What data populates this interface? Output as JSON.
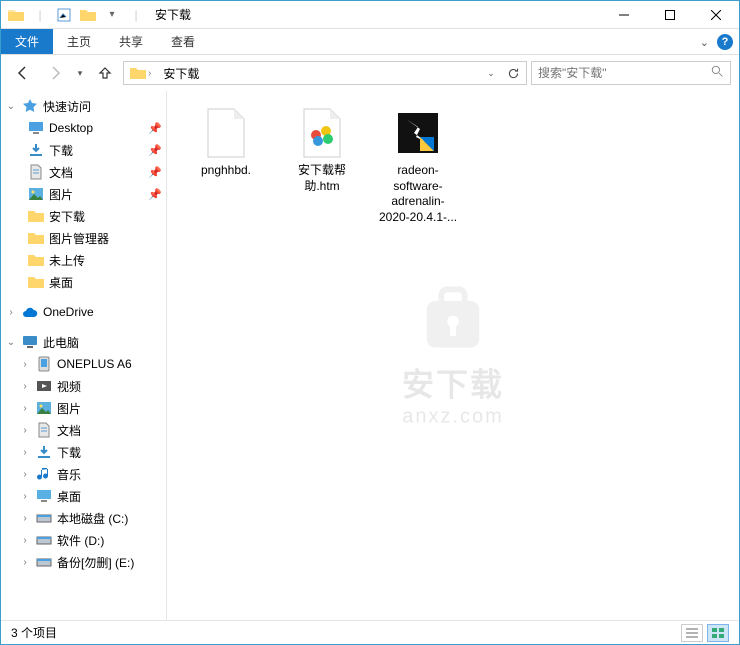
{
  "window": {
    "title": "安下载"
  },
  "ribbon": {
    "file": "文件",
    "home": "主页",
    "share": "共享",
    "view": "查看"
  },
  "nav": {
    "address_root_icon": "folder",
    "crumbs": [
      "安下载"
    ],
    "search_placeholder": "搜索\"安下载\""
  },
  "sidebar": {
    "quick_access": {
      "label": "快速访问",
      "expanded": true
    },
    "quick_items": [
      {
        "label": "Desktop",
        "icon": "desktop",
        "pinned": true
      },
      {
        "label": "下载",
        "icon": "downloads",
        "pinned": true
      },
      {
        "label": "文档",
        "icon": "documents",
        "pinned": true
      },
      {
        "label": "图片",
        "icon": "pictures",
        "pinned": true
      },
      {
        "label": "安下载",
        "icon": "folder",
        "pinned": false
      },
      {
        "label": "图片管理器",
        "icon": "folder",
        "pinned": false
      },
      {
        "label": "未上传",
        "icon": "folder",
        "pinned": false
      },
      {
        "label": "桌面",
        "icon": "folder",
        "pinned": false
      }
    ],
    "onedrive": {
      "label": "OneDrive"
    },
    "this_pc": {
      "label": "此电脑",
      "expanded": true
    },
    "pc_items": [
      {
        "label": "ONEPLUS A6",
        "icon": "phone"
      },
      {
        "label": "视频",
        "icon": "videos"
      },
      {
        "label": "图片",
        "icon": "pictures"
      },
      {
        "label": "文档",
        "icon": "documents"
      },
      {
        "label": "下载",
        "icon": "downloads"
      },
      {
        "label": "音乐",
        "icon": "music"
      },
      {
        "label": "桌面",
        "icon": "desktop-lib"
      },
      {
        "label": "本地磁盘 (C:)",
        "icon": "drive"
      },
      {
        "label": "软件 (D:)",
        "icon": "drive"
      },
      {
        "label": "备份[勿删] (E:)",
        "icon": "drive"
      }
    ]
  },
  "files": [
    {
      "name": "pnghhbd.",
      "type": "blank"
    },
    {
      "name": "安下载帮助.htm",
      "type": "htm"
    },
    {
      "name": "radeon-software-adrenalin-2020-20.4.1-...",
      "type": "installer"
    }
  ],
  "status": {
    "count_text": "3 个项目"
  },
  "watermark": {
    "main": "安下载",
    "sub": "anxz.com"
  }
}
